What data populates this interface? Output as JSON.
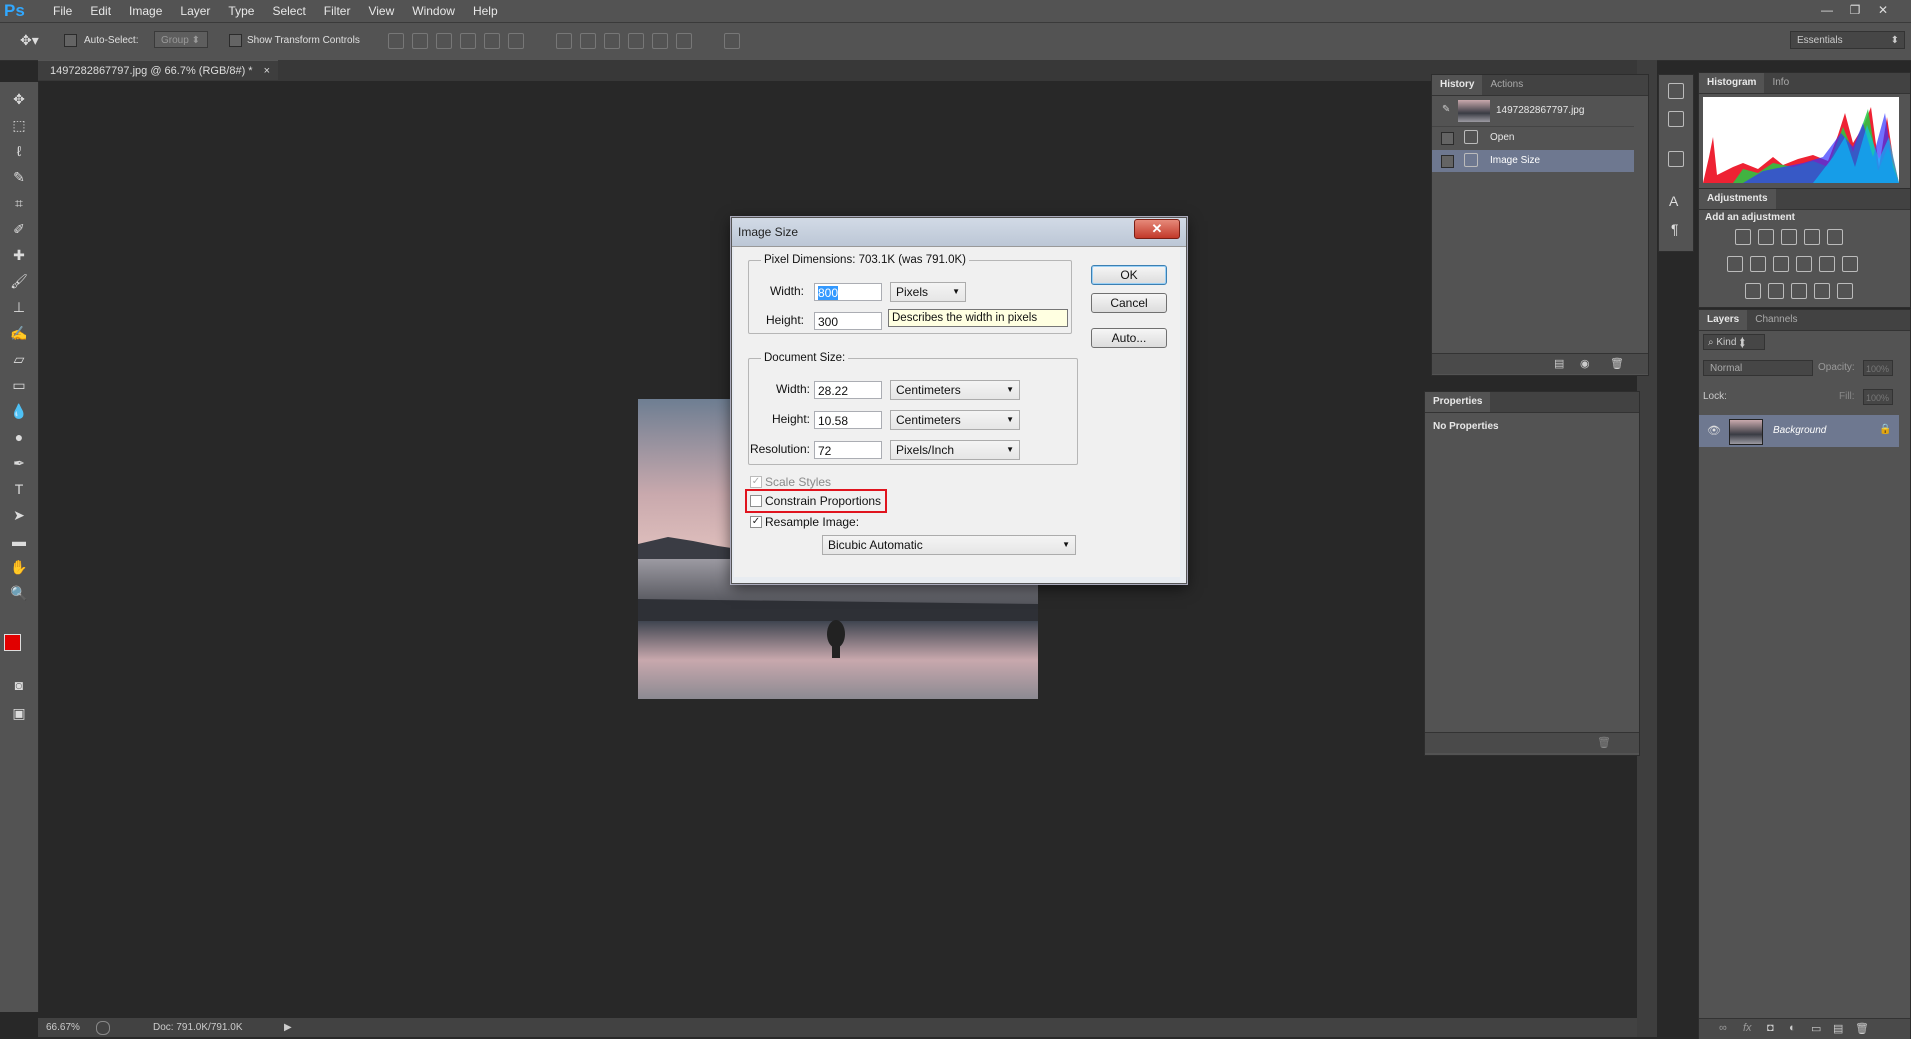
{
  "app": {
    "logo": "Ps"
  },
  "menu": [
    "File",
    "Edit",
    "Image",
    "Layer",
    "Type",
    "Select",
    "Filter",
    "View",
    "Window",
    "Help"
  ],
  "window_controls": {
    "minimize": "—",
    "restore": "❐",
    "close": "✕"
  },
  "options_bar": {
    "auto_select_label": "Auto-Select:",
    "auto_select_value": "Group",
    "show_transform_label": "Show Transform Controls",
    "workspace": "Essentials"
  },
  "document_tab": {
    "title": "1497282867797.jpg @ 66.7% (RGB/8#) *",
    "close": "×"
  },
  "status_bar": {
    "zoom": "66.67%",
    "doc": "Doc: 791.0K/791.0K"
  },
  "history_panel": {
    "tabs": [
      "History",
      "Actions"
    ],
    "snapshot": "1497282867797.jpg",
    "items": [
      "Open",
      "Image Size"
    ]
  },
  "properties_panel": {
    "title": "Properties",
    "empty": "No Properties"
  },
  "histogram_panel": {
    "tabs": [
      "Histogram",
      "Info"
    ]
  },
  "adjustments_panel": {
    "tab": "Adjustments",
    "heading": "Add an adjustment"
  },
  "layers_panel": {
    "tabs": [
      "Layers",
      "Channels"
    ],
    "kind": "Kind",
    "blend_mode": "Normal",
    "opacity_label": "Opacity:",
    "opacity_value": "100%",
    "lock_label": "Lock:",
    "fill_label": "Fill:",
    "fill_value": "100%",
    "layer_name": "Background"
  },
  "dialog": {
    "title": "Image Size",
    "close": "✕",
    "pixel_dimensions": "Pixel Dimensions:  703.1K (was 791.0K)",
    "pd_width_label": "Width:",
    "pd_width_value": "800",
    "pd_width_unit": "Pixels",
    "pd_height_label": "Height:",
    "pd_height_value": "300",
    "tooltip": "Describes the width in pixels",
    "document_size": "Document Size:",
    "ds_width_label": "Width:",
    "ds_width_value": "28.22",
    "ds_width_unit": "Centimeters",
    "ds_height_label": "Height:",
    "ds_height_value": "10.58",
    "ds_height_unit": "Centimeters",
    "resolution_label": "Resolution:",
    "resolution_value": "72",
    "resolution_unit": "Pixels/Inch",
    "scale_styles": "Scale Styles",
    "constrain": "Constrain Proportions",
    "resample": "Resample Image:",
    "resample_method": "Bicubic Automatic",
    "ok": "OK",
    "cancel": "Cancel",
    "auto": "Auto...",
    "highlight_color": "#e0141e"
  }
}
